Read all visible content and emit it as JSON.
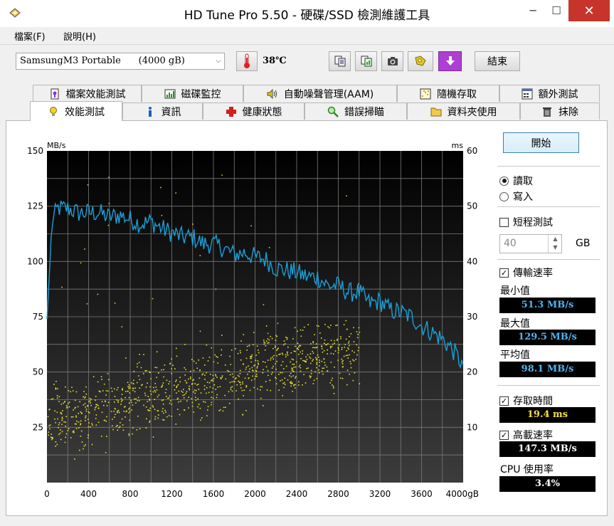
{
  "window": {
    "title": "HD Tune Pro 5.50 - 硬碟/SSD 檢測維護工具"
  },
  "menu": [
    {
      "label": "檔案(F)"
    },
    {
      "label": "說明(H)"
    }
  ],
  "toolbar": {
    "drive": "SamsungM3 Portable      (4000 gB)",
    "temperature": "38℃",
    "exit_label": "結束",
    "icons": [
      "copy-info-icon",
      "copy-screen-icon",
      "camera-icon",
      "options-icon",
      "save-arrow-icon"
    ]
  },
  "tabs_top": [
    {
      "label": "檔案效能測試",
      "icon": "file-benchmark-icon"
    },
    {
      "label": "磁碟監控",
      "icon": "monitor-icon"
    },
    {
      "label": "自動噪聲管理(AAM)",
      "icon": "speaker-icon"
    },
    {
      "label": "隨機存取",
      "icon": "random-access-icon"
    },
    {
      "label": "額外測試",
      "icon": "extra-tests-icon"
    }
  ],
  "tabs_bottom": [
    {
      "label": "效能測試",
      "icon": "benchmark-icon",
      "active": true
    },
    {
      "label": "資訊",
      "icon": "info-icon"
    },
    {
      "label": "健康狀態",
      "icon": "health-icon"
    },
    {
      "label": "錯誤掃瞄",
      "icon": "error-scan-icon"
    },
    {
      "label": "資料夾使用",
      "icon": "folder-icon"
    },
    {
      "label": "抹除",
      "icon": "trash-icon"
    }
  ],
  "controls": {
    "start_label": "開始",
    "read_label": "讀取",
    "write_label": "寫入",
    "mode": "read",
    "short_test_label": "短程測試",
    "short_test_checked": false,
    "short_test_size": "40",
    "size_unit": "GB",
    "transfer_rate_label": "傳輸速率",
    "transfer_rate_checked": true,
    "min_label": "最小值",
    "min_value": "51.3 MB/s",
    "max_label": "最大值",
    "max_value": "129.5 MB/s",
    "avg_label": "平均值",
    "avg_value": "98.1 MB/s",
    "access_time_label": "存取時間",
    "access_time_checked": true,
    "access_time_value": "19.4 ms",
    "burst_rate_label": "高載速率",
    "burst_rate_checked": true,
    "burst_rate_value": "147.3 MB/s",
    "cpu_label": "CPU 使用率",
    "cpu_value": "3.4%"
  },
  "chart_data": {
    "type": "line",
    "left_unit": "MB/s",
    "right_unit": "ms",
    "x_unit": "gB",
    "xlim": [
      0,
      4000
    ],
    "ylim": [
      0,
      150
    ],
    "y2lim": [
      0,
      60
    ],
    "x_ticks": [
      "0",
      "400",
      "800",
      "1200",
      "1600",
      "2000",
      "2400",
      "2800",
      "3200",
      "3600",
      "4000gB"
    ],
    "y_ticks": [
      "150",
      "125",
      "100",
      "75",
      "50",
      "25"
    ],
    "y2_ticks": [
      "60",
      "50",
      "40",
      "30",
      "20",
      "10"
    ],
    "grid": true,
    "colors": {
      "transfer": "#1aa0d8",
      "access": "#e8e030",
      "background": "#000000"
    },
    "series": [
      {
        "name": "傳輸速率",
        "x": [
          0,
          50,
          100,
          200,
          300,
          400,
          500,
          600,
          700,
          800,
          900,
          1000,
          1100,
          1200,
          1300,
          1400,
          1500,
          1600,
          1700,
          1800,
          1900,
          2000,
          2100,
          2200,
          2300,
          2400,
          2500,
          2600,
          2700,
          2800,
          2900,
          3000,
          3100,
          3200,
          3300,
          3400,
          3500,
          3600,
          3700,
          3800,
          3900,
          4000
        ],
        "values": [
          74,
          118,
          124,
          124,
          122,
          122,
          122,
          120,
          121,
          119,
          117,
          118,
          115,
          113,
          111,
          111,
          108,
          108,
          106,
          103,
          104,
          102,
          101,
          97,
          96,
          95,
          93,
          93,
          89,
          89,
          86,
          86,
          81,
          82,
          78,
          77,
          75,
          71,
          68,
          65,
          60,
          53
        ]
      },
      {
        "name": "存取時間",
        "type": "scatter",
        "x": [
          0,
          200,
          400,
          600,
          800,
          1000,
          1200,
          1400,
          1600,
          1800,
          2000,
          2200,
          2400,
          2600,
          2800,
          3000
        ],
        "values": [
          10.5,
          12,
          12.5,
          14,
          15.5,
          16,
          17.5,
          18,
          18.5,
          19,
          20.5,
          21,
          22,
          23,
          24,
          22.5
        ]
      }
    ]
  }
}
